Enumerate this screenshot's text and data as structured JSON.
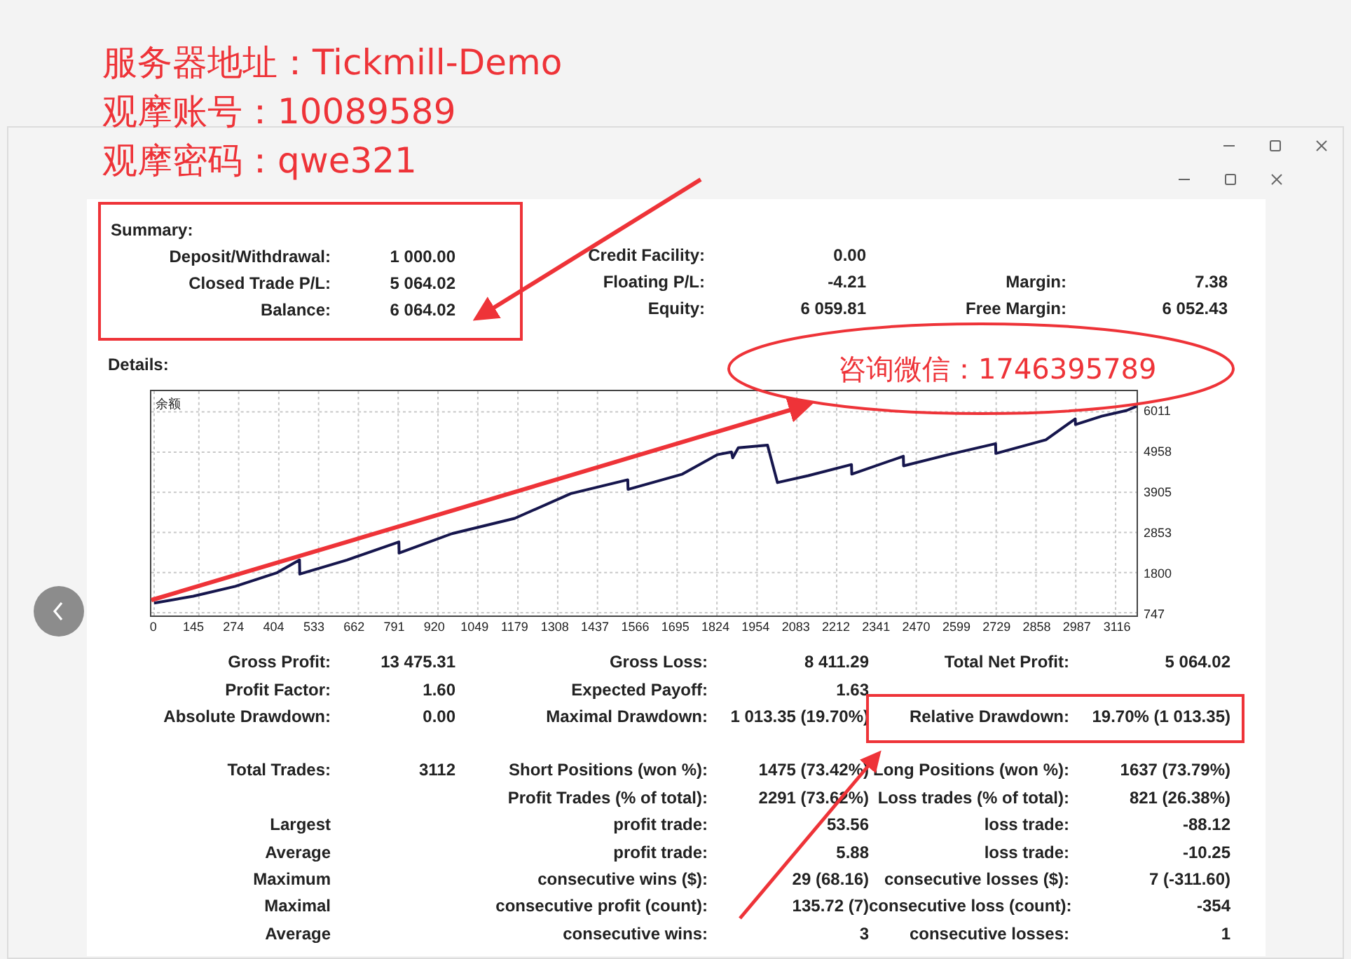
{
  "header_notes": [
    "服务器地址：Tickmill-Demo",
    "观摩账号：10089589",
    "观摩密码：qwe321"
  ],
  "contact_note": "咨询微信：1746395789",
  "summary": {
    "title": "Summary:",
    "highlighted": true,
    "rows": [
      {
        "left": {
          "label": "Deposit/Withdrawal:",
          "value": "1 000.00"
        },
        "middle": {
          "label": "Credit Facility:",
          "value": "0.00"
        }
      },
      {
        "left": {
          "label": "Closed Trade P/L:",
          "value": "5 064.02"
        },
        "middle": {
          "label": "Floating P/L:",
          "value": "-4.21"
        },
        "right": {
          "label": "Margin:",
          "value": "7.38"
        }
      },
      {
        "left": {
          "label": "Balance:",
          "value": "6 064.02"
        },
        "middle": {
          "label": "Equity:",
          "value": "6 059.81"
        },
        "right": {
          "label": "Free Margin:",
          "value": "6 052.43"
        }
      }
    ]
  },
  "details": {
    "title": "Details:",
    "chart_data": {
      "type": "line",
      "x": [
        0,
        127,
        263,
        399,
        471,
        472,
        625,
        793,
        794,
        965,
        1168,
        1350,
        1535,
        1536,
        1712,
        1825,
        1871,
        1875,
        1893,
        1988,
        2020,
        2120,
        2260,
        2261,
        2428,
        2429,
        2573,
        2727,
        2728,
        2890,
        2985,
        2986,
        3071,
        3152,
        3184
      ],
      "series": [
        {
          "name": "余额",
          "color": "#16164d",
          "values": [
            1000,
            1180,
            1440,
            1800,
            2130,
            1760,
            2130,
            2600,
            2310,
            2820,
            3220,
            3870,
            4230,
            3980,
            4380,
            4890,
            4960,
            4810,
            5070,
            5140,
            4160,
            4340,
            4630,
            4380,
            4850,
            4600,
            4890,
            5180,
            4920,
            5280,
            5830,
            5680,
            5900,
            6050,
            6160
          ]
        }
      ],
      "xlim": [
        -9,
        3184
      ],
      "ylim": [
        674,
        6555
      ],
      "grid": true,
      "xticks": [
        0,
        145,
        274,
        404,
        533,
        662,
        791,
        920,
        1049,
        1179,
        1308,
        1437,
        1566,
        1695,
        1824,
        1954,
        2083,
        2212,
        2341,
        2470,
        2599,
        2729,
        2858,
        2987,
        3116
      ],
      "yticks": [
        6011,
        4958,
        3905,
        2853,
        1800,
        747
      ]
    }
  },
  "stats": {
    "groups": [
      {
        "rows": [
          {
            "left": {
              "label": "Gross Profit:",
              "value": "13 475.31",
              "highlighted": false
            },
            "middle": {
              "label": "Gross Loss:",
              "value": "8 411.29",
              "highlighted": false
            },
            "right": {
              "label": "Total Net Profit:",
              "value": "5 064.02",
              "highlighted": false
            }
          },
          {
            "left": {
              "label": "Profit Factor:",
              "value": "1.60",
              "highlighted": false
            },
            "middle": {
              "label": "Expected Payoff:",
              "value": "1.63",
              "highlighted": false
            }
          },
          {
            "left": {
              "label": "Absolute Drawdown:",
              "value": "0.00",
              "highlighted": false
            },
            "middle": {
              "label": "Maximal Drawdown:",
              "value": "1 013.35 (19.70%)",
              "highlighted": false
            },
            "right": {
              "label": "Relative Drawdown:",
              "value": "19.70% (1 013.35)",
              "highlighted": true
            }
          }
        ]
      },
      {
        "rows": [
          {
            "left": {
              "label": "Total Trades:",
              "value": "3112",
              "highlighted": false
            },
            "middle": {
              "label": "Short Positions (won %):",
              "value": "1475 (73.42%)",
              "highlighted": false
            },
            "right": {
              "label": "Long Positions (won %):",
              "value": "1637 (73.79%)",
              "highlighted": false
            }
          },
          {
            "middle": {
              "label": "Profit Trades (% of total):",
              "value": "2291 (73.62%)",
              "highlighted": false
            },
            "right": {
              "label": "Loss trades (% of total):",
              "value": "821 (26.38%)",
              "highlighted": false
            }
          },
          {
            "left": {
              "label": "Largest",
              "highlighted": false
            },
            "middle": {
              "label": "profit trade:",
              "value": "53.56",
              "highlighted": false
            },
            "right": {
              "label": "loss trade:",
              "value": "-88.12",
              "highlighted": false
            }
          },
          {
            "left": {
              "label": "Average",
              "highlighted": false
            },
            "middle": {
              "label": "profit trade:",
              "value": "5.88",
              "highlighted": false
            },
            "right": {
              "label": "loss trade:",
              "value": "-10.25",
              "highlighted": false
            }
          },
          {
            "left": {
              "label": "Maximum",
              "highlighted": false
            },
            "middle": {
              "label": "consecutive wins ($):",
              "value": "29 (68.16)",
              "highlighted": false
            },
            "right": {
              "label": "consecutive losses ($):",
              "value": "7 (-311.60)",
              "highlighted": false
            }
          },
          {
            "left": {
              "label": "Maximal",
              "highlighted": false
            },
            "middle": {
              "label": "consecutive profit (count):",
              "value": "135.72 (7)",
              "highlighted": false
            },
            "right": {
              "label": "consecutive loss (count):",
              "value": "-354",
              "highlighted": false
            }
          },
          {
            "left": {
              "label": "Average",
              "highlighted": false
            },
            "middle": {
              "label": "consecutive wins:",
              "value": "3",
              "highlighted": false
            },
            "right": {
              "label": "consecutive losses:",
              "value": "1",
              "highlighted": false
            }
          }
        ]
      }
    ]
  }
}
